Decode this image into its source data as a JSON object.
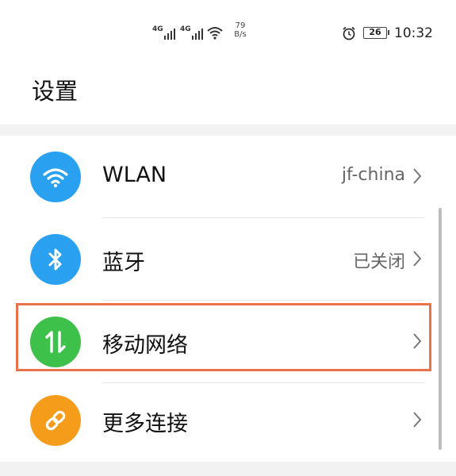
{
  "status_bar": {
    "network1": "4G",
    "network2": "4G",
    "speed_value": "79",
    "speed_unit": "B/s",
    "battery": "26",
    "time": "10:32",
    "icons": [
      "signal-icon",
      "wifi-icon",
      "alarm-icon",
      "battery-icon"
    ]
  },
  "page": {
    "title": "设置"
  },
  "settings_items": [
    {
      "label": "WLAN",
      "value": "jf-china",
      "icon": "wifi-icon",
      "color": "#2aa0f0"
    },
    {
      "label": "蓝牙",
      "value": "已关闭",
      "icon": "bluetooth-icon",
      "color": "#2aa0f0"
    },
    {
      "label": "移动网络",
      "value": "",
      "icon": "mobile-data-icon",
      "color": "#3ec14b"
    },
    {
      "label": "更多连接",
      "value": "",
      "icon": "link-icon",
      "color": "#f59c1a"
    }
  ],
  "highlight_color": "#e8734a"
}
